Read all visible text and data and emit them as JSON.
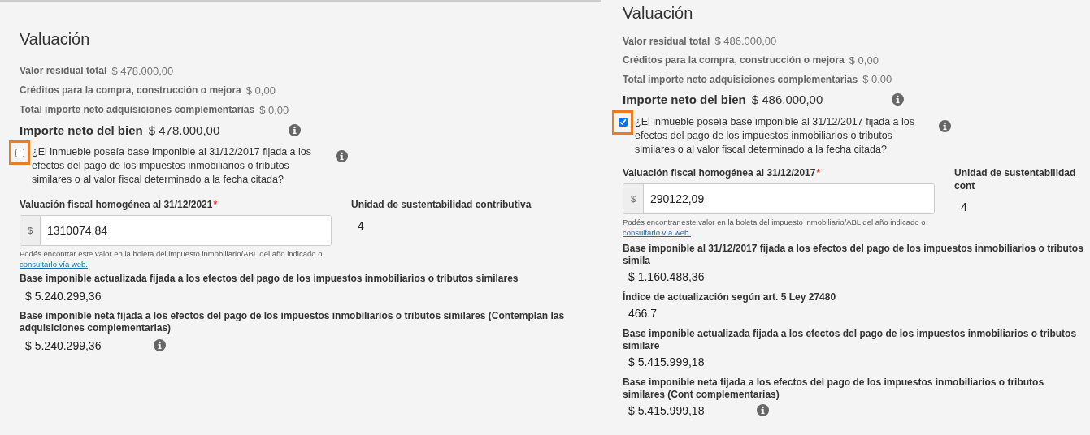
{
  "panels": [
    {
      "title": "Valuación",
      "summary": [
        {
          "label": "Valor residual total",
          "value": "$ 478.000,00"
        },
        {
          "label": "Créditos para la compra, construcción o mejora",
          "value": "$ 0,00"
        },
        {
          "label": "Total importe neto adquisiciones complementarias",
          "value": "$ 0,00"
        }
      ],
      "net": {
        "label": "Importe neto del bien",
        "value": "$ 478.000,00"
      },
      "question": {
        "text": "¿El inmueble poseía base imponible al 31/12/2017 fijada a los efectos del pago de los impuestos inmobiliarios o tributos similares o al valor fiscal determinado a la fecha citada?",
        "checked": false,
        "highlighted": true
      },
      "field": {
        "label": "Valuación fiscal homogénea al 31/12/2021",
        "required_mark": "*",
        "prefix": "$",
        "value": "1310074,84",
        "hint": "Podés encontrar este valor en la boleta del impuesto inmobiliario/ABL del año indicado o",
        "link": "consultarlo vía web."
      },
      "unit": {
        "label": "Unidad de sustentabilidad contributiva",
        "value": "4"
      },
      "results": [
        {
          "label": "Base imponible actualizada fijada a los efectos del pago de los impuestos inmobiliarios o tributos similares",
          "value": "$ 5.240.299,36",
          "info": false
        },
        {
          "label": "Base imponible neta fijada a los efectos del pago de los impuestos inmobiliarios o tributos similares (Contemplan las adquisiciones complementarias)",
          "value": "$ 5.240.299,36",
          "info": true
        }
      ]
    },
    {
      "title": "Valuación",
      "summary": [
        {
          "label": "Valor residual total",
          "value": "$ 486.000,00"
        },
        {
          "label": "Créditos para la compra, construcción o mejora",
          "value": "$ 0,00"
        },
        {
          "label": "Total importe neto adquisiciones complementarias",
          "value": "$ 0,00"
        }
      ],
      "net": {
        "label": "Importe neto del bien",
        "value": "$ 486.000,00"
      },
      "question": {
        "text": "¿El inmueble poseía base imponible al 31/12/2017 fijada a los efectos del pago de los impuestos inmobiliarios o tributos similares o al valor fiscal determinado a la fecha citada?",
        "checked": true,
        "highlighted": true
      },
      "field": {
        "label": "Valuación fiscal homogénea al 31/12/2017",
        "required_mark": "*",
        "prefix": "$",
        "value": "290122,09",
        "hint": "Podés encontrar este valor en la boleta del impuesto inmobiliario/ABL del año indicado o",
        "link": "consultarlo vía web."
      },
      "unit": {
        "label": "Unidad de sustentabilidad cont",
        "value": "4"
      },
      "results": [
        {
          "label": "Base imponible al 31/12/2017 fijada a los efectos del pago de los impuestos inmobiliarios o tributos simila",
          "value": "$ 1.160.488,36",
          "info": false
        },
        {
          "label": "Índice de actualización según art. 5 Ley 27480",
          "value": "466.7",
          "info": false
        },
        {
          "label": "Base imponible actualizada fijada a los efectos del pago de los impuestos inmobiliarios o tributos similare",
          "value": "$ 5.415.999,18",
          "info": false
        },
        {
          "label": "Base imponible neta fijada a los efectos del pago de los impuestos inmobiliarios o tributos similares (Cont complementarias)",
          "value": "$ 5.415.999,18",
          "info": true
        }
      ]
    }
  ]
}
